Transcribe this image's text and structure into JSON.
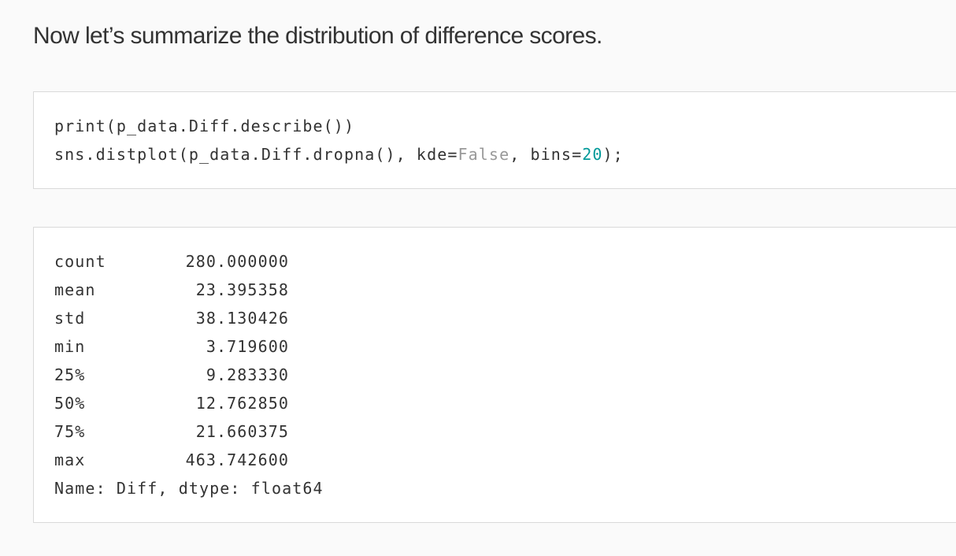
{
  "heading": "Now let’s summarize the distribution of difference scores.",
  "code": {
    "line1": "print(p_data.Diff.describe())",
    "line2_prefix": "sns.distplot(p_data.Diff.dropna(), kde=",
    "line2_false": "False",
    "line2_middle": ", bins=",
    "line2_num": "20",
    "line2_suffix": ");"
  },
  "output": {
    "rows": [
      {
        "label": "count",
        "value": "280.000000"
      },
      {
        "label": "mean",
        "value": "23.395358"
      },
      {
        "label": "std",
        "value": "38.130426"
      },
      {
        "label": "min",
        "value": "3.719600"
      },
      {
        "label": "25%",
        "value": "9.283330"
      },
      {
        "label": "50%",
        "value": "12.762850"
      },
      {
        "label": "75%",
        "value": "21.660375"
      },
      {
        "label": "max",
        "value": "463.742600"
      }
    ],
    "dtype_line": "Name: Diff, dtype: float64"
  },
  "colors": {
    "page_background": "#fafafa",
    "block_background": "#ffffff",
    "block_border": "#dadada",
    "text": "#333333",
    "keyword_false": "#999999",
    "number": "#009999"
  }
}
